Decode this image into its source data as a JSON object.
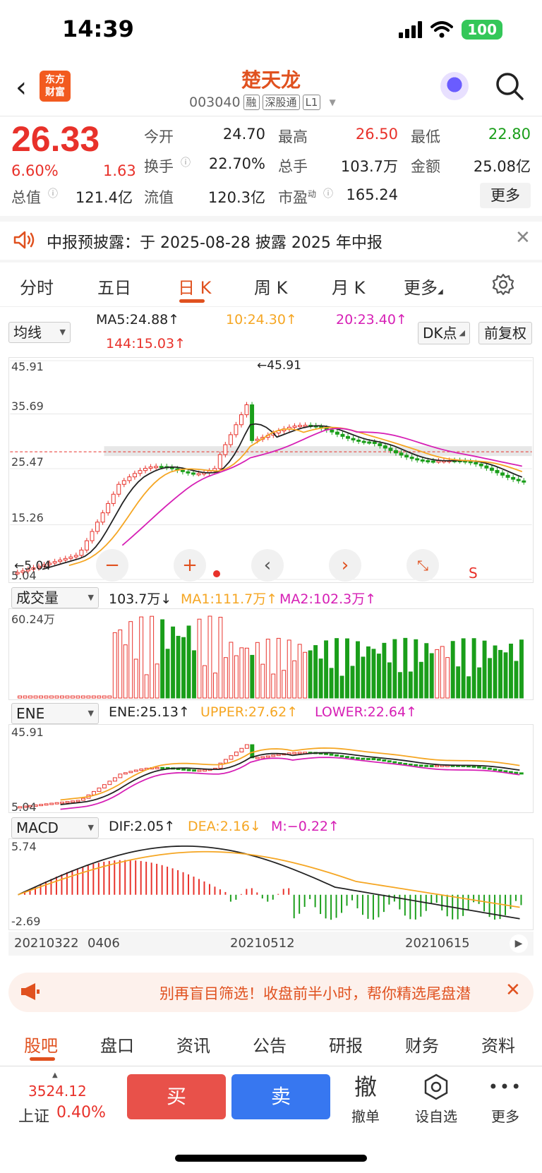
{
  "status_bar": {
    "time": "14:39",
    "battery": "100"
  },
  "header": {
    "logo_line1": "东方",
    "logo_line2": "财富",
    "stock_name": "楚天龙",
    "stock_code": "003040",
    "tags": [
      "融",
      "深股通",
      "L1"
    ]
  },
  "quote": {
    "price": "26.33",
    "change_pct": "6.60%",
    "change_abs": "1.63",
    "fields": [
      {
        "label": "今开",
        "value": "24.70"
      },
      {
        "label": "最高",
        "value": "26.50"
      },
      {
        "label": "最低",
        "value": "22.80"
      },
      {
        "label": "换手",
        "value": "22.70%"
      },
      {
        "label": "总手",
        "value": "103.7万"
      },
      {
        "label": "金额",
        "value": "25.08亿"
      },
      {
        "label": "总值",
        "value": "121.4亿"
      },
      {
        "label": "流值",
        "value": "120.3亿"
      },
      {
        "label": "市盈",
        "label_sup": "动",
        "value": "165.24"
      }
    ],
    "more_label": "更多"
  },
  "notice": {
    "text": "中报预披露：于 2025-08-28 披露 2025 年中报"
  },
  "period_tabs": [
    "分时",
    "五日",
    "日 K",
    "周 K",
    "月 K",
    "更多"
  ],
  "kline": {
    "indicator_select": "均线",
    "ma5": "MA5:24.88",
    "ma10": "10:24.30",
    "ma20": "20:23.40",
    "ma144": "144:15.03",
    "dk_label": "DK点",
    "adjust_label": "前复权",
    "y_ticks": [
      "45.91",
      "35.69",
      "25.47",
      "15.26",
      "5.04"
    ],
    "high_label": "45.91",
    "low_label": "5.04",
    "s_marker": "S"
  },
  "volume": {
    "select": "成交量",
    "vol": "103.7万",
    "ma1": "MA1:111.7万",
    "ma2": "MA2:102.3万",
    "max_label": "60.24万"
  },
  "ene": {
    "select": "ENE",
    "ene": "ENE:25.13",
    "upper": "UPPER:27.62",
    "lower": "LOWER:22.64",
    "top": "45.91",
    "bottom": "5.04"
  },
  "macd": {
    "select": "MACD",
    "dif": "DIF:2.05",
    "dea": "DEA:2.16",
    "m": "M:−0.22",
    "top": "5.74",
    "bottom": "-2.69"
  },
  "x_dates": [
    "20210322",
    "0406",
    "20210512",
    "20210615"
  ],
  "promo": {
    "text": "别再盲目筛选！收盘前半小时，帮你精选尾盘潜"
  },
  "bottom_tabs": [
    "股吧",
    "盘口",
    "资讯",
    "公告",
    "研报",
    "财务",
    "资料"
  ],
  "action_bar": {
    "index_value": "3524.12",
    "index_name": "上证",
    "index_pct": "0.40%",
    "buy": "买",
    "sell": "卖",
    "cancel_icon": "撤",
    "cancel_label": "撤单",
    "watch_label": "设自选",
    "more_label": "更多"
  },
  "colors": {
    "up": "#e8312a",
    "down": "#1a9e1a",
    "brand": "#e0511f",
    "ma10": "#f5a623",
    "ma20": "#d61fb5"
  }
}
